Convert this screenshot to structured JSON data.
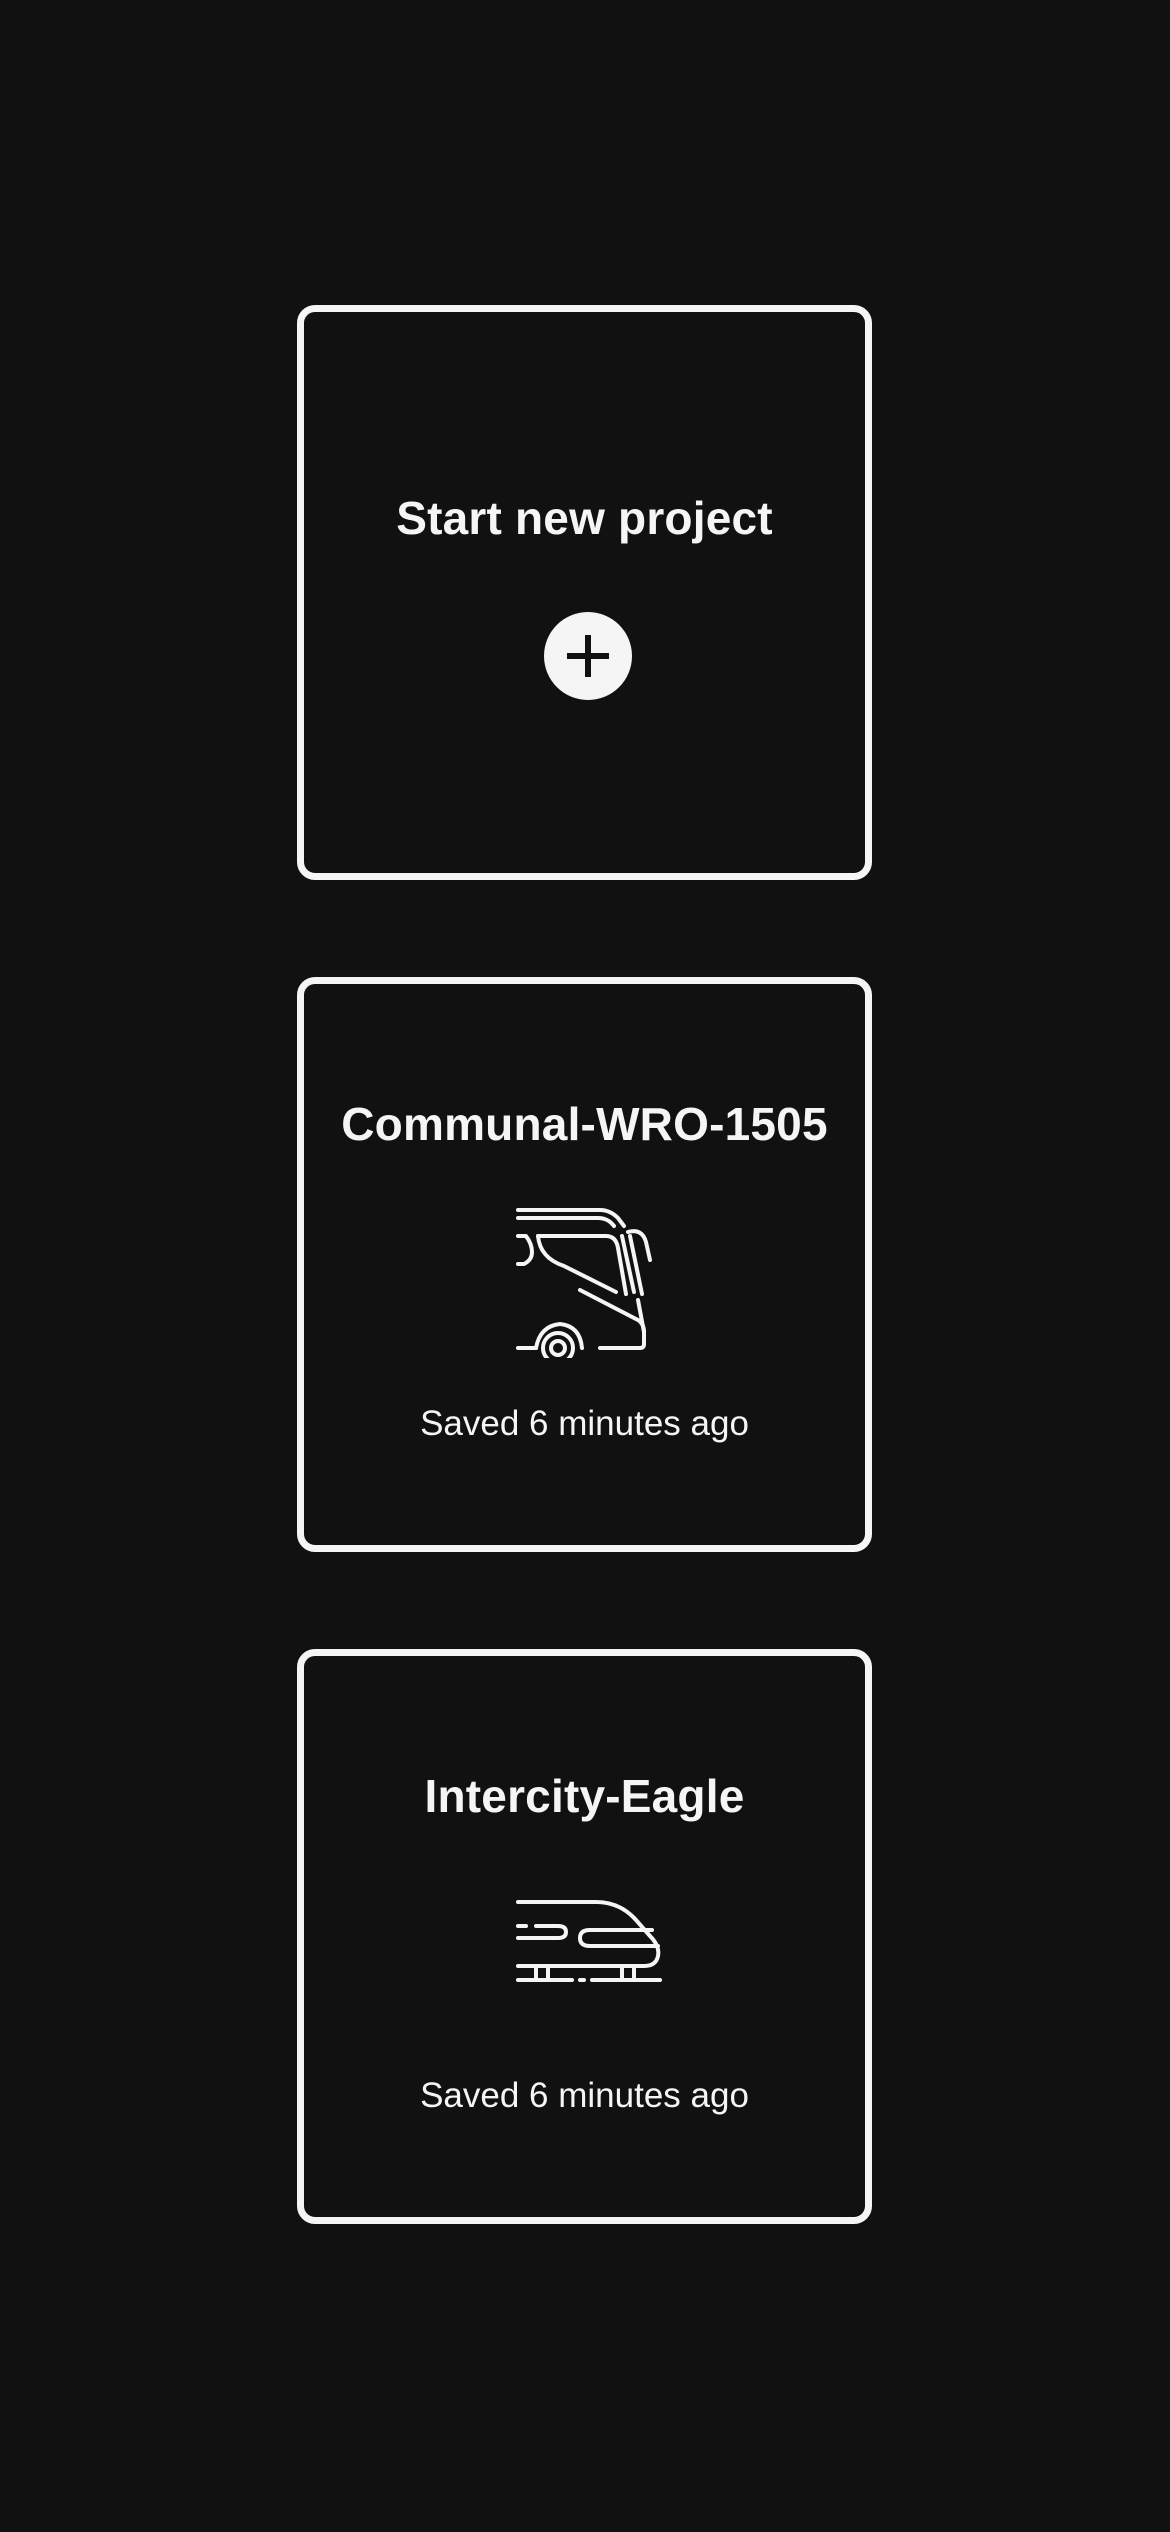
{
  "new_project": {
    "title": "Start new project",
    "icon": "plus-circle-icon"
  },
  "projects": [
    {
      "name": "Communal-WRO-1505",
      "icon": "bus-icon",
      "status": "Saved 6 minutes ago"
    },
    {
      "name": "Intercity-Eagle",
      "icon": "high-speed-train-icon",
      "status": "Saved 6 minutes ago"
    }
  ],
  "colors": {
    "background": "#111111",
    "foreground": "#f5f5f5"
  }
}
